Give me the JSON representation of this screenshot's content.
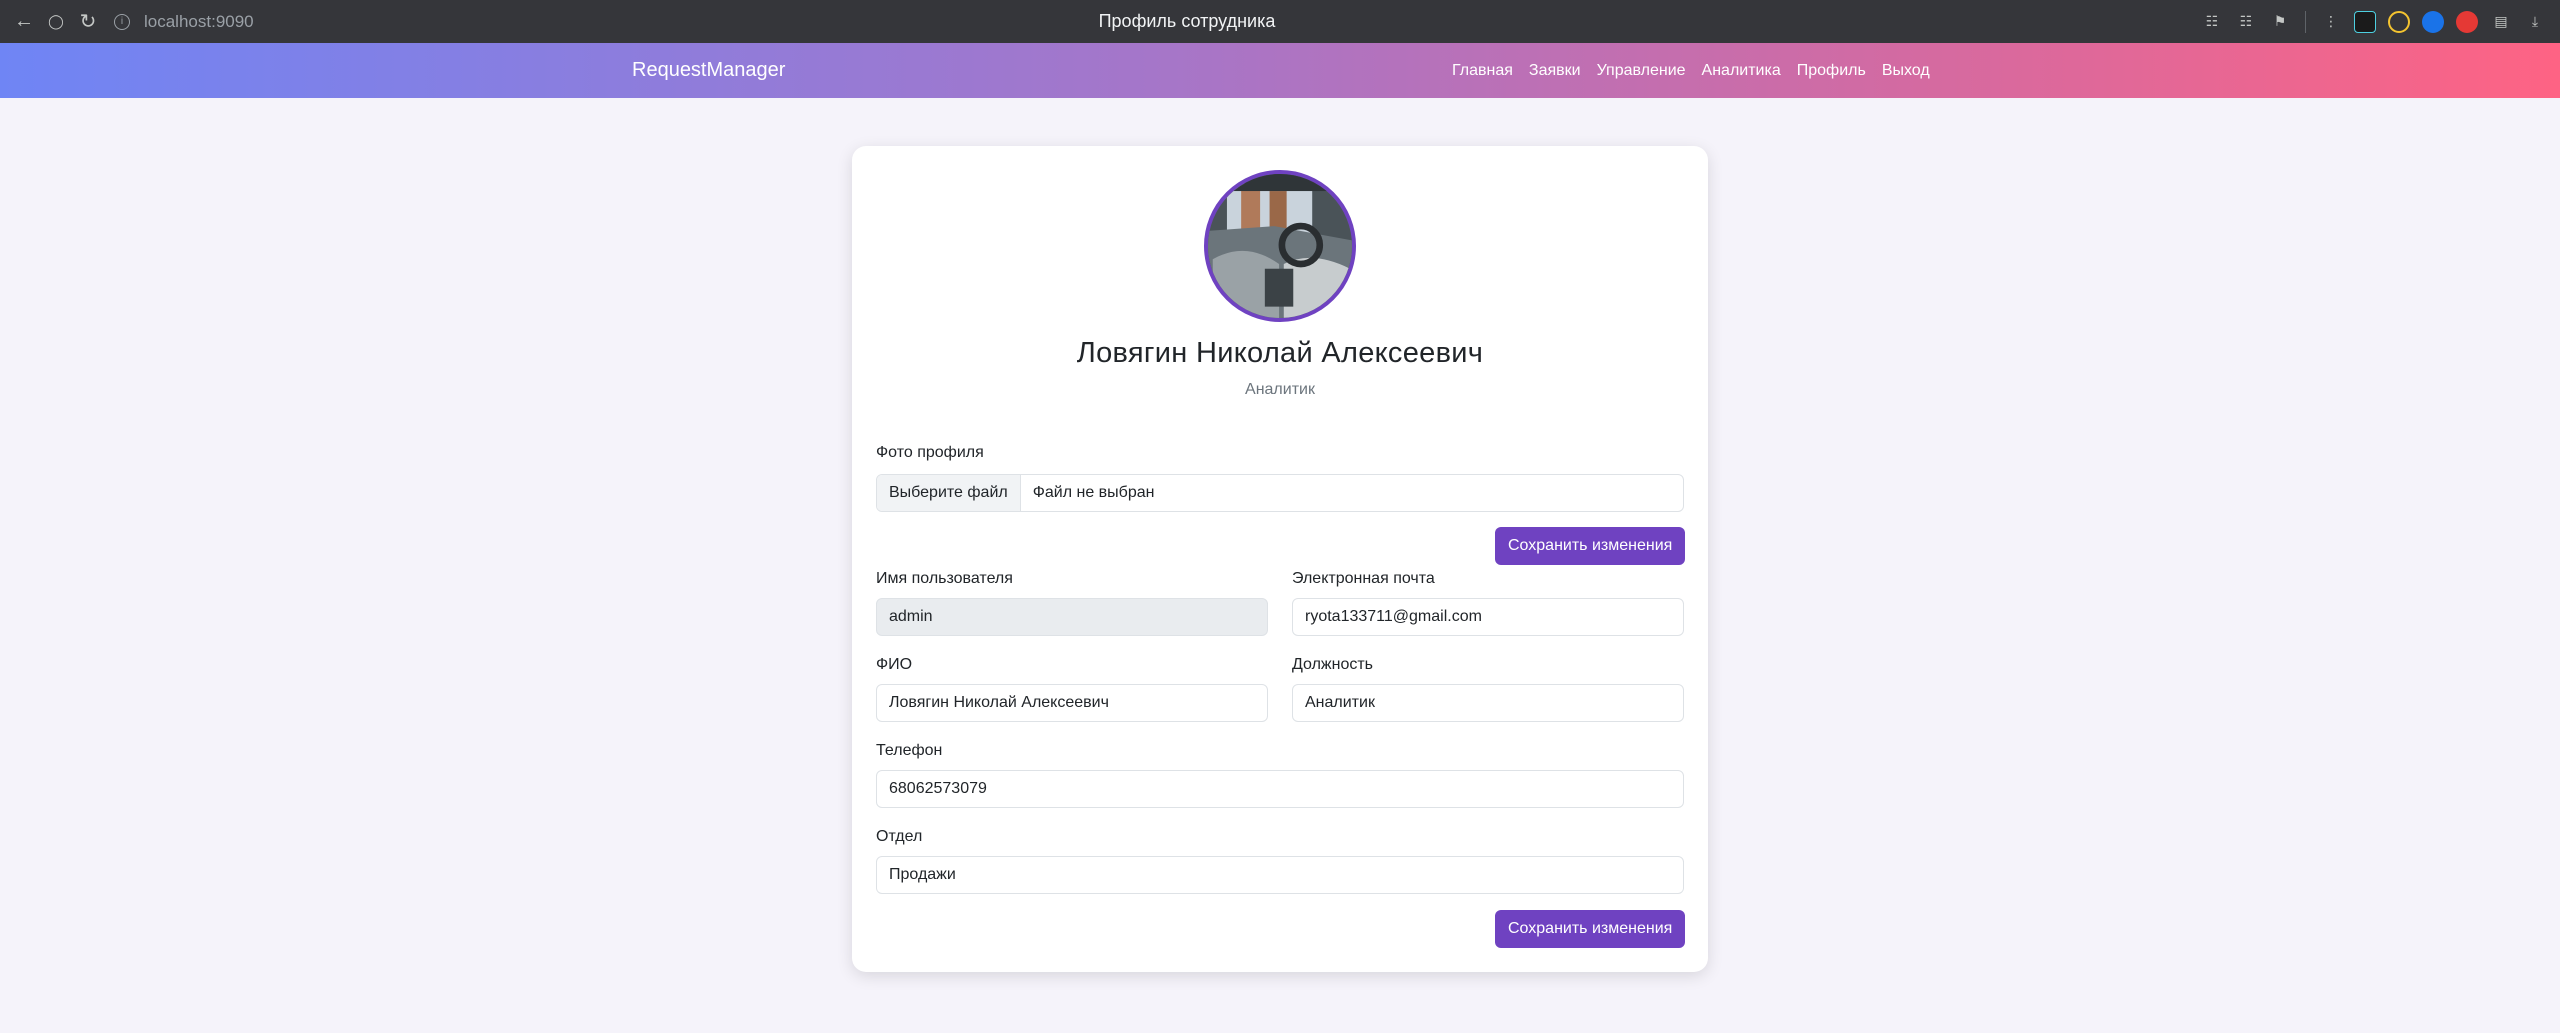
{
  "browser": {
    "url": "localhost:9090",
    "tab_title": "Профиль сотрудника"
  },
  "navbar": {
    "brand": "RequestManager",
    "links": [
      "Главная",
      "Заявки",
      "Управление",
      "Аналитика",
      "Профиль",
      "Выход"
    ]
  },
  "profile": {
    "name": "Ловягин Николай Алексеевич",
    "role": "Аналитик",
    "photo_label": "Фото профиля",
    "file_button": "Выберите файл",
    "file_status": "Файл не выбран",
    "save_label": "Сохранить изменения"
  },
  "form": {
    "username_label": "Имя пользователя",
    "username_value": "admin",
    "email_label": "Электронная почта",
    "email_value": "ryota133711@gmail.com",
    "fio_label": "ФИО",
    "fio_value": "Ловягин Николай Алексеевич",
    "position_label": "Должность",
    "position_value": "Аналитик",
    "phone_label": "Телефон",
    "phone_value": "68062573079",
    "department_label": "Отдел",
    "department_value": "Продажи",
    "save_label": "Сохранить изменения"
  },
  "colors": {
    "primary": "#6f42c1",
    "gradient_start": "#6f85f5",
    "gradient_end": "#fe6384",
    "page_bg": "#f5f3fa"
  }
}
